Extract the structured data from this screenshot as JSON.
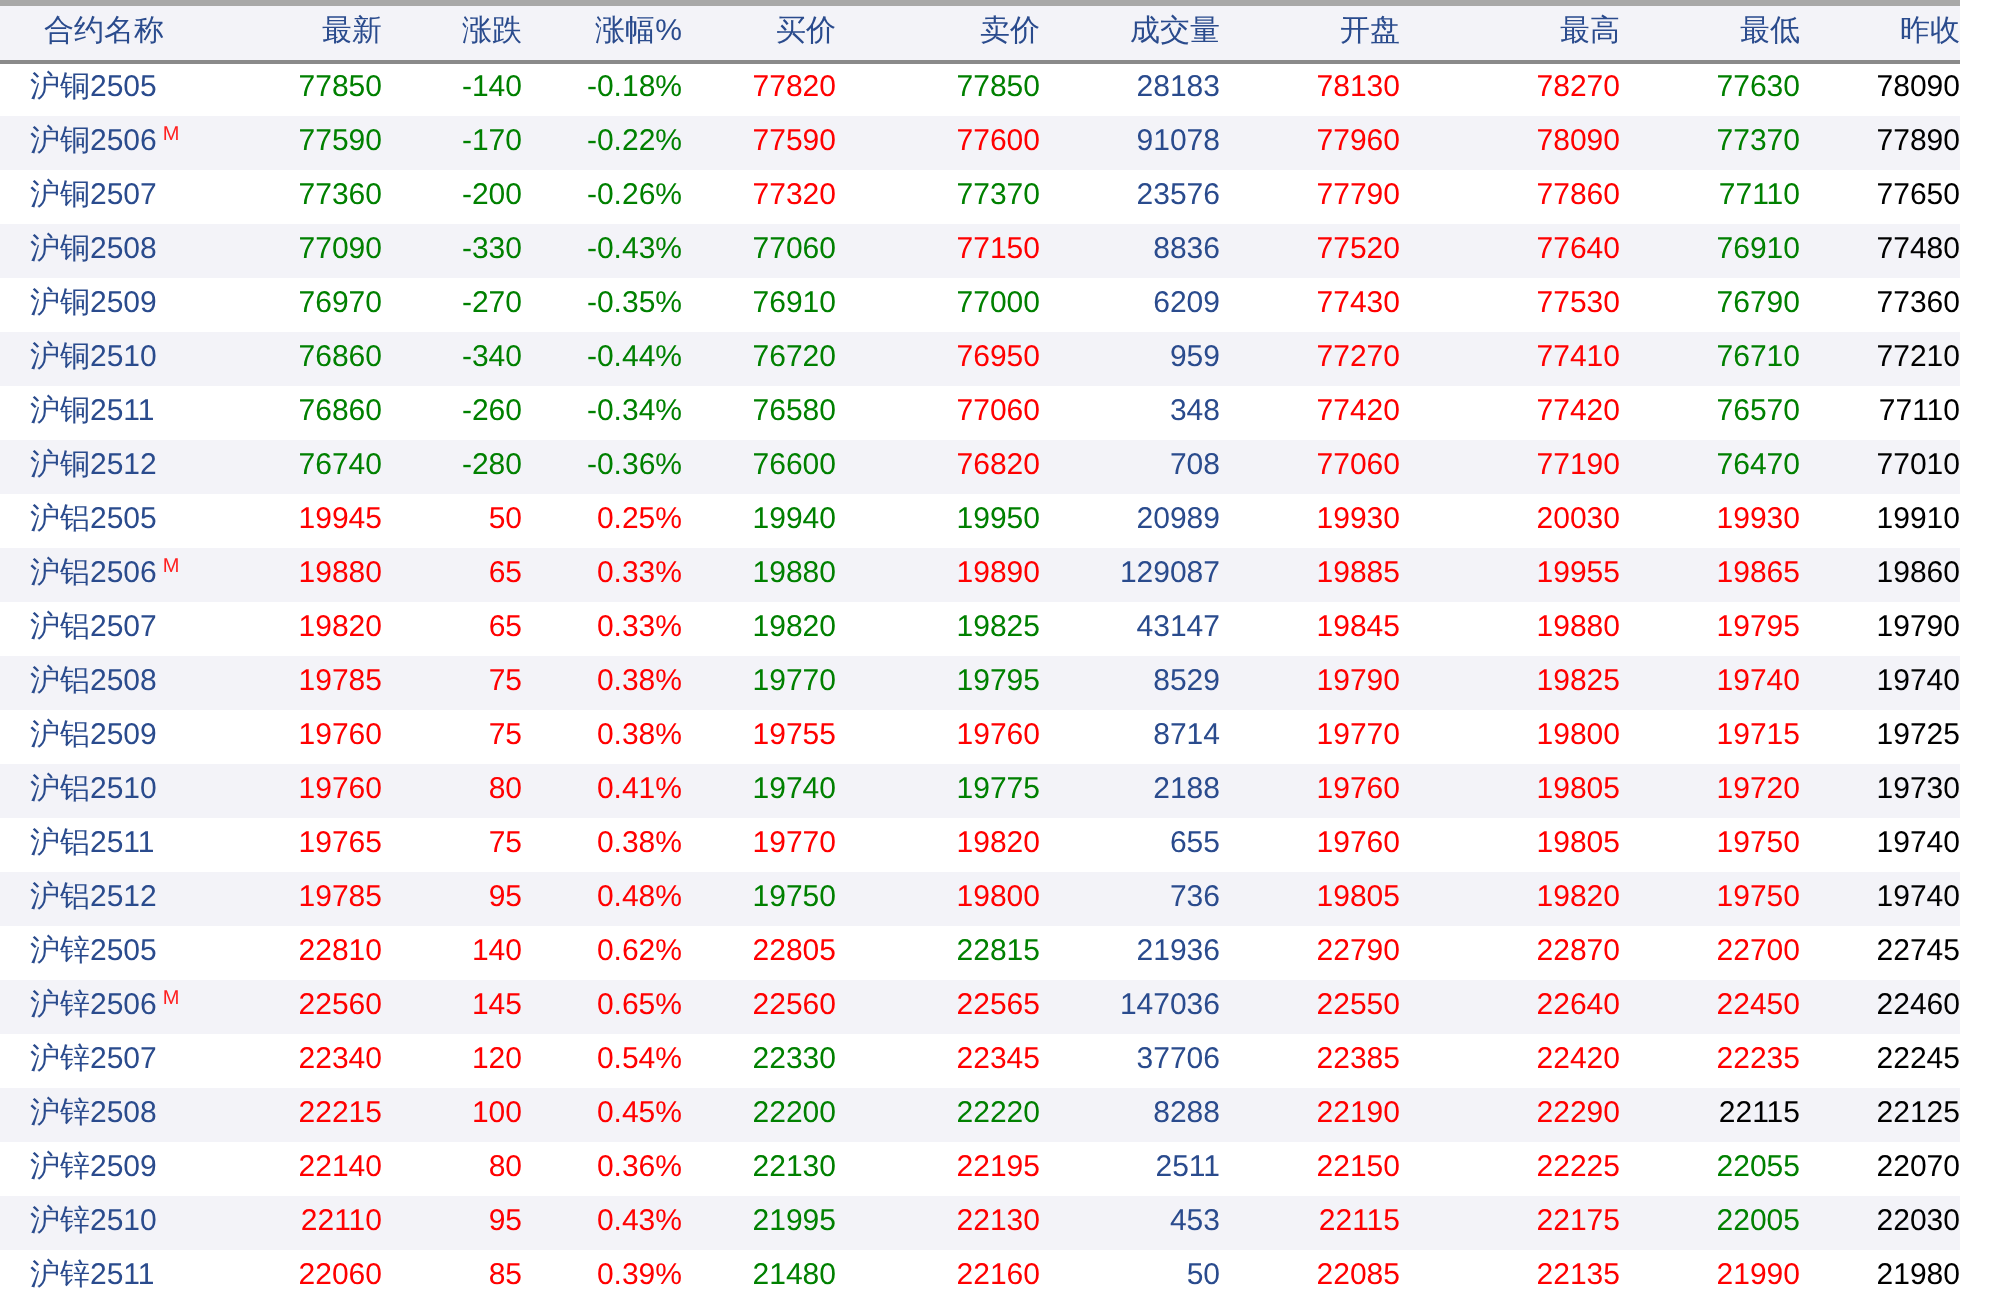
{
  "table": {
    "columns": [
      "合约名称",
      "最新",
      "涨跌",
      "涨幅%",
      "买价",
      "卖价",
      "成交量",
      "开盘",
      "最高",
      "最低",
      "昨收"
    ],
    "rows": [
      {
        "cells": [
          {
            "text": "沪铜2505"
          },
          {
            "text": "77850",
            "color": "#008000"
          },
          {
            "text": "-140",
            "color": "#008000"
          },
          {
            "text": "-0.18%",
            "color": "#008000"
          },
          {
            "text": "77820",
            "color": "#ff0000"
          },
          {
            "text": "77850",
            "color": "#008000"
          },
          {
            "text": "28183",
            "color": "#2a4b8d"
          },
          {
            "text": "78130",
            "color": "#ff0000"
          },
          {
            "text": "78270",
            "color": "#ff0000"
          },
          {
            "text": "77630",
            "color": "#008000"
          },
          {
            "text": "78090",
            "color": "#000000"
          }
        ]
      },
      {
        "cells": [
          {
            "text": "沪铜2506",
            "badge": "M"
          },
          {
            "text": "77590",
            "color": "#008000"
          },
          {
            "text": "-170",
            "color": "#008000"
          },
          {
            "text": "-0.22%",
            "color": "#008000"
          },
          {
            "text": "77590",
            "color": "#ff0000"
          },
          {
            "text": "77600",
            "color": "#ff0000"
          },
          {
            "text": "91078",
            "color": "#2a4b8d"
          },
          {
            "text": "77960",
            "color": "#ff0000"
          },
          {
            "text": "78090",
            "color": "#ff0000"
          },
          {
            "text": "77370",
            "color": "#008000"
          },
          {
            "text": "77890",
            "color": "#000000"
          }
        ]
      },
      {
        "cells": [
          {
            "text": "沪铜2507"
          },
          {
            "text": "77360",
            "color": "#008000"
          },
          {
            "text": "-200",
            "color": "#008000"
          },
          {
            "text": "-0.26%",
            "color": "#008000"
          },
          {
            "text": "77320",
            "color": "#ff0000"
          },
          {
            "text": "77370",
            "color": "#008000"
          },
          {
            "text": "23576",
            "color": "#2a4b8d"
          },
          {
            "text": "77790",
            "color": "#ff0000"
          },
          {
            "text": "77860",
            "color": "#ff0000"
          },
          {
            "text": "77110",
            "color": "#008000"
          },
          {
            "text": "77650",
            "color": "#000000"
          }
        ]
      },
      {
        "cells": [
          {
            "text": "沪铜2508"
          },
          {
            "text": "77090",
            "color": "#008000"
          },
          {
            "text": "-330",
            "color": "#008000"
          },
          {
            "text": "-0.43%",
            "color": "#008000"
          },
          {
            "text": "77060",
            "color": "#008000"
          },
          {
            "text": "77150",
            "color": "#ff0000"
          },
          {
            "text": "8836",
            "color": "#2a4b8d"
          },
          {
            "text": "77520",
            "color": "#ff0000"
          },
          {
            "text": "77640",
            "color": "#ff0000"
          },
          {
            "text": "76910",
            "color": "#008000"
          },
          {
            "text": "77480",
            "color": "#000000"
          }
        ]
      },
      {
        "cells": [
          {
            "text": "沪铜2509"
          },
          {
            "text": "76970",
            "color": "#008000"
          },
          {
            "text": "-270",
            "color": "#008000"
          },
          {
            "text": "-0.35%",
            "color": "#008000"
          },
          {
            "text": "76910",
            "color": "#008000"
          },
          {
            "text": "77000",
            "color": "#008000"
          },
          {
            "text": "6209",
            "color": "#2a4b8d"
          },
          {
            "text": "77430",
            "color": "#ff0000"
          },
          {
            "text": "77530",
            "color": "#ff0000"
          },
          {
            "text": "76790",
            "color": "#008000"
          },
          {
            "text": "77360",
            "color": "#000000"
          }
        ]
      },
      {
        "cells": [
          {
            "text": "沪铜2510"
          },
          {
            "text": "76860",
            "color": "#008000"
          },
          {
            "text": "-340",
            "color": "#008000"
          },
          {
            "text": "-0.44%",
            "color": "#008000"
          },
          {
            "text": "76720",
            "color": "#008000"
          },
          {
            "text": "76950",
            "color": "#ff0000"
          },
          {
            "text": "959",
            "color": "#2a4b8d"
          },
          {
            "text": "77270",
            "color": "#ff0000"
          },
          {
            "text": "77410",
            "color": "#ff0000"
          },
          {
            "text": "76710",
            "color": "#008000"
          },
          {
            "text": "77210",
            "color": "#000000"
          }
        ]
      },
      {
        "cells": [
          {
            "text": "沪铜2511"
          },
          {
            "text": "76860",
            "color": "#008000"
          },
          {
            "text": "-260",
            "color": "#008000"
          },
          {
            "text": "-0.34%",
            "color": "#008000"
          },
          {
            "text": "76580",
            "color": "#008000"
          },
          {
            "text": "77060",
            "color": "#ff0000"
          },
          {
            "text": "348",
            "color": "#2a4b8d"
          },
          {
            "text": "77420",
            "color": "#ff0000"
          },
          {
            "text": "77420",
            "color": "#ff0000"
          },
          {
            "text": "76570",
            "color": "#008000"
          },
          {
            "text": "77110",
            "color": "#000000"
          }
        ]
      },
      {
        "cells": [
          {
            "text": "沪铜2512"
          },
          {
            "text": "76740",
            "color": "#008000"
          },
          {
            "text": "-280",
            "color": "#008000"
          },
          {
            "text": "-0.36%",
            "color": "#008000"
          },
          {
            "text": "76600",
            "color": "#008000"
          },
          {
            "text": "76820",
            "color": "#ff0000"
          },
          {
            "text": "708",
            "color": "#2a4b8d"
          },
          {
            "text": "77060",
            "color": "#ff0000"
          },
          {
            "text": "77190",
            "color": "#ff0000"
          },
          {
            "text": "76470",
            "color": "#008000"
          },
          {
            "text": "77010",
            "color": "#000000"
          }
        ]
      },
      {
        "cells": [
          {
            "text": "沪铝2505"
          },
          {
            "text": "19945",
            "color": "#ff0000"
          },
          {
            "text": "50",
            "color": "#ff0000"
          },
          {
            "text": "0.25%",
            "color": "#ff0000"
          },
          {
            "text": "19940",
            "color": "#008000"
          },
          {
            "text": "19950",
            "color": "#008000"
          },
          {
            "text": "20989",
            "color": "#2a4b8d"
          },
          {
            "text": "19930",
            "color": "#ff0000"
          },
          {
            "text": "20030",
            "color": "#ff0000"
          },
          {
            "text": "19930",
            "color": "#ff0000"
          },
          {
            "text": "19910",
            "color": "#000000"
          }
        ]
      },
      {
        "cells": [
          {
            "text": "沪铝2506",
            "badge": "M"
          },
          {
            "text": "19880",
            "color": "#ff0000"
          },
          {
            "text": "65",
            "color": "#ff0000"
          },
          {
            "text": "0.33%",
            "color": "#ff0000"
          },
          {
            "text": "19880",
            "color": "#008000"
          },
          {
            "text": "19890",
            "color": "#ff0000"
          },
          {
            "text": "129087",
            "color": "#2a4b8d"
          },
          {
            "text": "19885",
            "color": "#ff0000"
          },
          {
            "text": "19955",
            "color": "#ff0000"
          },
          {
            "text": "19865",
            "color": "#ff0000"
          },
          {
            "text": "19860",
            "color": "#000000"
          }
        ]
      },
      {
        "cells": [
          {
            "text": "沪铝2507"
          },
          {
            "text": "19820",
            "color": "#ff0000"
          },
          {
            "text": "65",
            "color": "#ff0000"
          },
          {
            "text": "0.33%",
            "color": "#ff0000"
          },
          {
            "text": "19820",
            "color": "#008000"
          },
          {
            "text": "19825",
            "color": "#008000"
          },
          {
            "text": "43147",
            "color": "#2a4b8d"
          },
          {
            "text": "19845",
            "color": "#ff0000"
          },
          {
            "text": "19880",
            "color": "#ff0000"
          },
          {
            "text": "19795",
            "color": "#ff0000"
          },
          {
            "text": "19790",
            "color": "#000000"
          }
        ]
      },
      {
        "cells": [
          {
            "text": "沪铝2508"
          },
          {
            "text": "19785",
            "color": "#ff0000"
          },
          {
            "text": "75",
            "color": "#ff0000"
          },
          {
            "text": "0.38%",
            "color": "#ff0000"
          },
          {
            "text": "19770",
            "color": "#008000"
          },
          {
            "text": "19795",
            "color": "#008000"
          },
          {
            "text": "8529",
            "color": "#2a4b8d"
          },
          {
            "text": "19790",
            "color": "#ff0000"
          },
          {
            "text": "19825",
            "color": "#ff0000"
          },
          {
            "text": "19740",
            "color": "#ff0000"
          },
          {
            "text": "19740",
            "color": "#000000"
          }
        ]
      },
      {
        "cells": [
          {
            "text": "沪铝2509"
          },
          {
            "text": "19760",
            "color": "#ff0000"
          },
          {
            "text": "75",
            "color": "#ff0000"
          },
          {
            "text": "0.38%",
            "color": "#ff0000"
          },
          {
            "text": "19755",
            "color": "#ff0000"
          },
          {
            "text": "19760",
            "color": "#ff0000"
          },
          {
            "text": "8714",
            "color": "#2a4b8d"
          },
          {
            "text": "19770",
            "color": "#ff0000"
          },
          {
            "text": "19800",
            "color": "#ff0000"
          },
          {
            "text": "19715",
            "color": "#ff0000"
          },
          {
            "text": "19725",
            "color": "#000000"
          }
        ]
      },
      {
        "cells": [
          {
            "text": "沪铝2510"
          },
          {
            "text": "19760",
            "color": "#ff0000"
          },
          {
            "text": "80",
            "color": "#ff0000"
          },
          {
            "text": "0.41%",
            "color": "#ff0000"
          },
          {
            "text": "19740",
            "color": "#008000"
          },
          {
            "text": "19775",
            "color": "#008000"
          },
          {
            "text": "2188",
            "color": "#2a4b8d"
          },
          {
            "text": "19760",
            "color": "#ff0000"
          },
          {
            "text": "19805",
            "color": "#ff0000"
          },
          {
            "text": "19720",
            "color": "#ff0000"
          },
          {
            "text": "19730",
            "color": "#000000"
          }
        ]
      },
      {
        "cells": [
          {
            "text": "沪铝2511"
          },
          {
            "text": "19765",
            "color": "#ff0000"
          },
          {
            "text": "75",
            "color": "#ff0000"
          },
          {
            "text": "0.38%",
            "color": "#ff0000"
          },
          {
            "text": "19770",
            "color": "#ff0000"
          },
          {
            "text": "19820",
            "color": "#ff0000"
          },
          {
            "text": "655",
            "color": "#2a4b8d"
          },
          {
            "text": "19760",
            "color": "#ff0000"
          },
          {
            "text": "19805",
            "color": "#ff0000"
          },
          {
            "text": "19750",
            "color": "#ff0000"
          },
          {
            "text": "19740",
            "color": "#000000"
          }
        ]
      },
      {
        "cells": [
          {
            "text": "沪铝2512"
          },
          {
            "text": "19785",
            "color": "#ff0000"
          },
          {
            "text": "95",
            "color": "#ff0000"
          },
          {
            "text": "0.48%",
            "color": "#ff0000"
          },
          {
            "text": "19750",
            "color": "#008000"
          },
          {
            "text": "19800",
            "color": "#ff0000"
          },
          {
            "text": "736",
            "color": "#2a4b8d"
          },
          {
            "text": "19805",
            "color": "#ff0000"
          },
          {
            "text": "19820",
            "color": "#ff0000"
          },
          {
            "text": "19750",
            "color": "#ff0000"
          },
          {
            "text": "19740",
            "color": "#000000"
          }
        ]
      },
      {
        "cells": [
          {
            "text": "沪锌2505"
          },
          {
            "text": "22810",
            "color": "#ff0000"
          },
          {
            "text": "140",
            "color": "#ff0000"
          },
          {
            "text": "0.62%",
            "color": "#ff0000"
          },
          {
            "text": "22805",
            "color": "#ff0000"
          },
          {
            "text": "22815",
            "color": "#008000"
          },
          {
            "text": "21936",
            "color": "#2a4b8d"
          },
          {
            "text": "22790",
            "color": "#ff0000"
          },
          {
            "text": "22870",
            "color": "#ff0000"
          },
          {
            "text": "22700",
            "color": "#ff0000"
          },
          {
            "text": "22745",
            "color": "#000000"
          }
        ]
      },
      {
        "cells": [
          {
            "text": "沪锌2506",
            "badge": "M"
          },
          {
            "text": "22560",
            "color": "#ff0000"
          },
          {
            "text": "145",
            "color": "#ff0000"
          },
          {
            "text": "0.65%",
            "color": "#ff0000"
          },
          {
            "text": "22560",
            "color": "#ff0000"
          },
          {
            "text": "22565",
            "color": "#ff0000"
          },
          {
            "text": "147036",
            "color": "#2a4b8d"
          },
          {
            "text": "22550",
            "color": "#ff0000"
          },
          {
            "text": "22640",
            "color": "#ff0000"
          },
          {
            "text": "22450",
            "color": "#ff0000"
          },
          {
            "text": "22460",
            "color": "#000000"
          }
        ]
      },
      {
        "cells": [
          {
            "text": "沪锌2507"
          },
          {
            "text": "22340",
            "color": "#ff0000"
          },
          {
            "text": "120",
            "color": "#ff0000"
          },
          {
            "text": "0.54%",
            "color": "#ff0000"
          },
          {
            "text": "22330",
            "color": "#008000"
          },
          {
            "text": "22345",
            "color": "#ff0000"
          },
          {
            "text": "37706",
            "color": "#2a4b8d"
          },
          {
            "text": "22385",
            "color": "#ff0000"
          },
          {
            "text": "22420",
            "color": "#ff0000"
          },
          {
            "text": "22235",
            "color": "#ff0000"
          },
          {
            "text": "22245",
            "color": "#000000"
          }
        ]
      },
      {
        "cells": [
          {
            "text": "沪锌2508"
          },
          {
            "text": "22215",
            "color": "#ff0000"
          },
          {
            "text": "100",
            "color": "#ff0000"
          },
          {
            "text": "0.45%",
            "color": "#ff0000"
          },
          {
            "text": "22200",
            "color": "#008000"
          },
          {
            "text": "22220",
            "color": "#008000"
          },
          {
            "text": "8288",
            "color": "#2a4b8d"
          },
          {
            "text": "22190",
            "color": "#ff0000"
          },
          {
            "text": "22290",
            "color": "#ff0000"
          },
          {
            "text": "22115",
            "color": "#000000"
          },
          {
            "text": "22125",
            "color": "#000000"
          }
        ]
      },
      {
        "cells": [
          {
            "text": "沪锌2509"
          },
          {
            "text": "22140",
            "color": "#ff0000"
          },
          {
            "text": "80",
            "color": "#ff0000"
          },
          {
            "text": "0.36%",
            "color": "#ff0000"
          },
          {
            "text": "22130",
            "color": "#008000"
          },
          {
            "text": "22195",
            "color": "#ff0000"
          },
          {
            "text": "2511",
            "color": "#2a4b8d"
          },
          {
            "text": "22150",
            "color": "#ff0000"
          },
          {
            "text": "22225",
            "color": "#ff0000"
          },
          {
            "text": "22055",
            "color": "#008000"
          },
          {
            "text": "22070",
            "color": "#000000"
          }
        ]
      },
      {
        "cells": [
          {
            "text": "沪锌2510"
          },
          {
            "text": "22110",
            "color": "#ff0000"
          },
          {
            "text": "95",
            "color": "#ff0000"
          },
          {
            "text": "0.43%",
            "color": "#ff0000"
          },
          {
            "text": "21995",
            "color": "#008000"
          },
          {
            "text": "22130",
            "color": "#ff0000"
          },
          {
            "text": "453",
            "color": "#2a4b8d"
          },
          {
            "text": "22115",
            "color": "#ff0000"
          },
          {
            "text": "22175",
            "color": "#ff0000"
          },
          {
            "text": "22005",
            "color": "#008000"
          },
          {
            "text": "22030",
            "color": "#000000"
          }
        ]
      },
      {
        "cells": [
          {
            "text": "沪锌2511"
          },
          {
            "text": "22060",
            "color": "#ff0000"
          },
          {
            "text": "85",
            "color": "#ff0000"
          },
          {
            "text": "0.39%",
            "color": "#ff0000"
          },
          {
            "text": "21480",
            "color": "#008000"
          },
          {
            "text": "22160",
            "color": "#ff0000"
          },
          {
            "text": "50",
            "color": "#2a4b8d"
          },
          {
            "text": "22085",
            "color": "#ff0000"
          },
          {
            "text": "22135",
            "color": "#ff0000"
          },
          {
            "text": "21990",
            "color": "#ff0000"
          },
          {
            "text": "21980",
            "color": "#000000"
          }
        ]
      }
    ]
  }
}
